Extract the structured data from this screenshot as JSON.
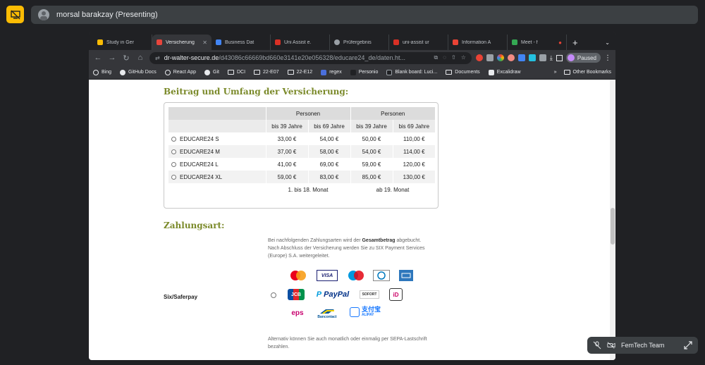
{
  "meet": {
    "presenter_label": "morsal barakzay (Presenting)",
    "participant_name": "FemTech Team"
  },
  "browser": {
    "tabs": [
      {
        "label": "Study in Ger",
        "color": "#fbbc04"
      },
      {
        "label": "Versicherung",
        "color": "#e8453c",
        "active": true
      },
      {
        "label": "Business Dat",
        "color": "#4285f4"
      },
      {
        "label": "Uni Assist e.",
        "color": "#d93025"
      },
      {
        "label": "Prüfergebnis",
        "color": "#9aa0a6"
      },
      {
        "label": "uni-assist ur",
        "color": "#d93025"
      },
      {
        "label": "Information A",
        "color": "#ea4335"
      },
      {
        "label": "Meet - f",
        "color": "#34a853"
      }
    ],
    "new_tab": "+",
    "url_host": "dr-walter-secure.de",
    "url_path": "/d43086c66669bd660e3141e20e056328/educare24_de/daten.ht...",
    "profile_status": "Paused",
    "bookmarks": [
      "Bing",
      "GitHub Docs",
      "React App",
      "Git",
      "DCI",
      "22-E07",
      "22-E12",
      "regex",
      "Personio",
      "Blank board: Luci...",
      "Documents",
      "Excalidraw"
    ],
    "bookmarks_more": "»",
    "other_bookmarks": "Other Bookmarks"
  },
  "page": {
    "section_insurance": "Beitrag und Umfang der Versicherung:",
    "table": {
      "group_header": "Personen",
      "sub_headers": [
        "bis 39 Jahre",
        "bis 69 Jahre",
        "bis 39 Jahre",
        "bis 69 Jahre"
      ],
      "rows": [
        {
          "name": "EDUCARE24 S",
          "values": [
            "33,00 €",
            "54,00 €",
            "50,00 €",
            "110,00 €"
          ]
        },
        {
          "name": "EDUCARE24 M",
          "values": [
            "37,00 €",
            "58,00 €",
            "54,00 €",
            "114,00 €"
          ]
        },
        {
          "name": "EDUCARE24 L",
          "values": [
            "41,00 €",
            "69,00 €",
            "59,00 €",
            "120,00 €"
          ]
        },
        {
          "name": "EDUCARE24 XL",
          "values": [
            "59,00 €",
            "83,00 €",
            "85,00 €",
            "130,00 €"
          ]
        }
      ],
      "footer_left": "1. bis 18. Monat",
      "footer_right": "ab 19. Monat"
    },
    "section_payment": "Zahlungsart:",
    "payment_intro_1": "Bei nachfolgenden Zahlungsarten wird der",
    "payment_intro_bold": "Gesamtbetrag",
    "payment_intro_2": "abgebucht.",
    "payment_intro_3": "Nach Abschluss der Versicherung werden Sie zu SIX Payment Services (Europe) S.A. weitergeleitet.",
    "method_label": "Six/Saferpay",
    "logos": {
      "visa": "VISA",
      "paypal": "PayPal",
      "jcb": "JCB",
      "sofort": "SOFORT",
      "ideal": "iD",
      "eps": "eps",
      "bancontact": "Bancontact",
      "alipay": "支付宝",
      "alipay_sub": "ALIPAY"
    },
    "sepa_note": "Alternativ können Sie auch monatlich oder einmalig per SEPA-Lastschrift bezahlen."
  }
}
